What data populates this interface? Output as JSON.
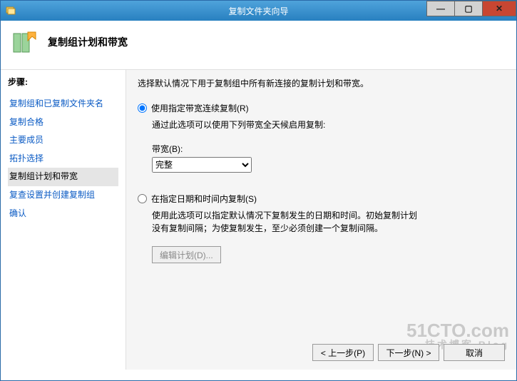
{
  "window": {
    "title": "复制文件夹向导"
  },
  "header": {
    "title": "复制组计划和带宽"
  },
  "sidebar": {
    "steps_label": "步骤:",
    "items": [
      {
        "label": "复制组和已复制文件夹名"
      },
      {
        "label": "复制合格"
      },
      {
        "label": "主要成员"
      },
      {
        "label": "拓扑选择"
      },
      {
        "label": "复制组计划和带宽"
      },
      {
        "label": "复查设置并创建复制组"
      },
      {
        "label": "确认"
      }
    ],
    "active_index": 4
  },
  "main": {
    "description": "选择默认情况下用于复制组中所有新连接的复制计划和带宽。",
    "option1": {
      "label": "使用指定带宽连续复制(R)",
      "help": "通过此选项可以使用下列带宽全天候启用复制:",
      "bandwidth_label": "带宽(B):",
      "bandwidth_value": "完整"
    },
    "option2": {
      "label": "在指定日期和时间内复制(S)",
      "help": "使用此选项可以指定默认情况下复制发生的日期和时间。初始复制计划没有复制间隔；为使复制发生，至少必须创建一个复制间隔。"
    },
    "edit_schedule_btn": "编辑计划(D)..."
  },
  "footer": {
    "prev": "< 上一步(P)",
    "next": "下一步(N) >",
    "cancel": "取消"
  },
  "watermark": {
    "main": "51CTO.com",
    "sub": "技术博客  Blog"
  }
}
